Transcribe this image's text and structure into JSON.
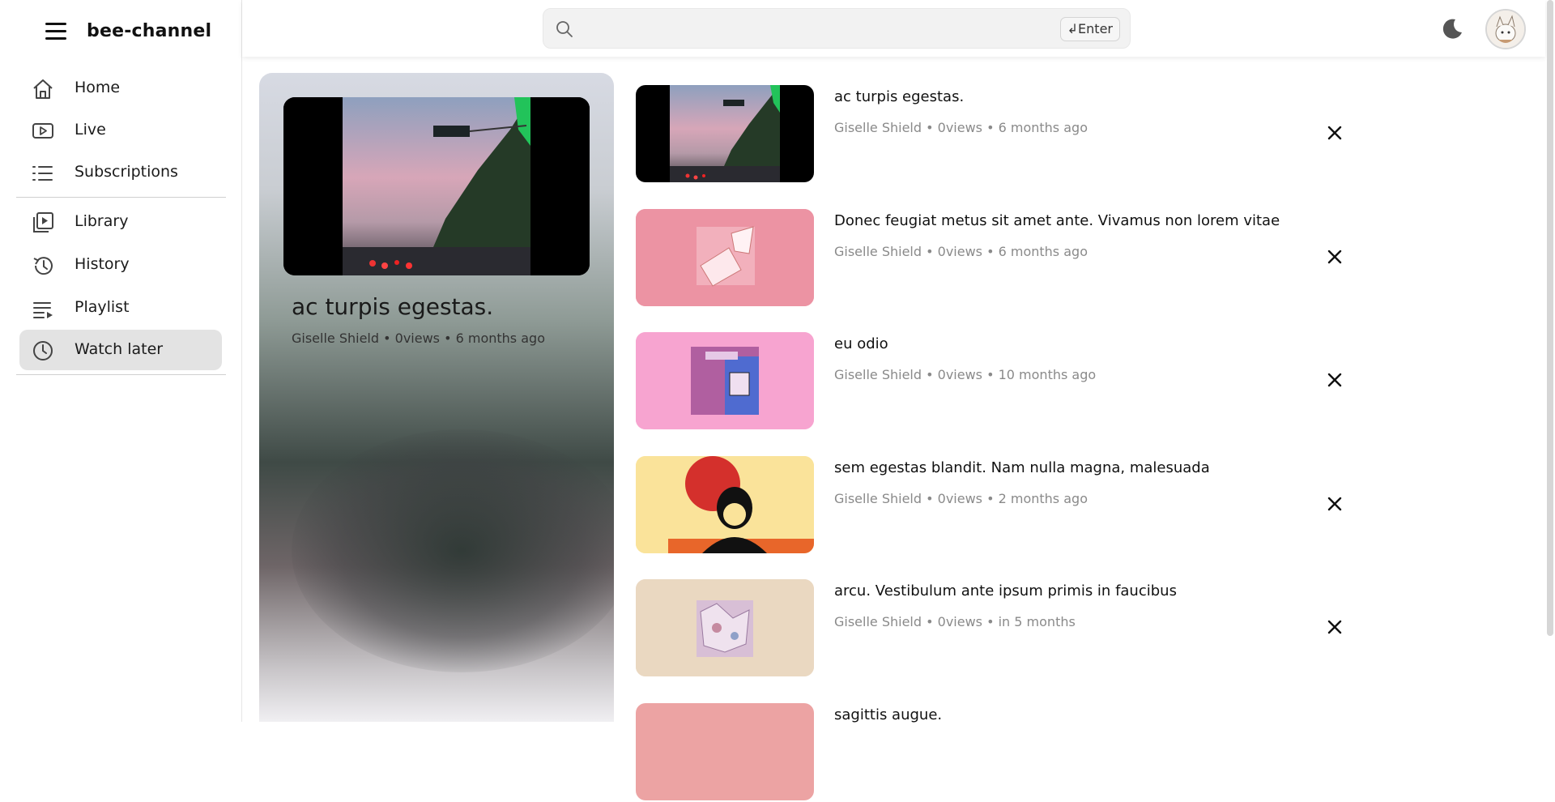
{
  "app": {
    "name": "bee-channel"
  },
  "sidebar": {
    "items": [
      {
        "label": "Home",
        "icon": "home-icon",
        "active": false
      },
      {
        "label": "Live",
        "icon": "live-icon",
        "active": false
      },
      {
        "label": "Subscriptions",
        "icon": "list-icon",
        "active": false
      },
      {
        "label": "Library",
        "icon": "library-icon",
        "active": false
      },
      {
        "label": "History",
        "icon": "history-icon",
        "active": false
      },
      {
        "label": "Playlist",
        "icon": "playlist-icon",
        "active": false
      },
      {
        "label": "Watch later",
        "icon": "clock-icon",
        "active": true
      }
    ]
  },
  "header": {
    "search_placeholder": "",
    "enter_key": "↲Enter",
    "theme_icon": "moon-icon",
    "avatar_icon": "avatar"
  },
  "hero": {
    "title": "ac turpis egestas.",
    "meta": "Giselle Shield • 0views • 6 months ago"
  },
  "videos": [
    {
      "title": "ac turpis egestas.",
      "meta": "Giselle Shield • 0views • 6 months ago",
      "thumb_bg": "#000000"
    },
    {
      "title": "Donec feugiat metus sit amet ante. Vivamus non lorem vitae",
      "meta": "Giselle Shield • 0views • 6 months ago",
      "thumb_bg": "#ec93a3"
    },
    {
      "title": "eu odio",
      "meta": "Giselle Shield • 0views • 10 months ago",
      "thumb_bg": "#f7a4d0"
    },
    {
      "title": "sem egestas blandit. Nam nulla magna, malesuada",
      "meta": "Giselle Shield • 0views • 2 months ago",
      "thumb_bg": "#fae39a"
    },
    {
      "title": "arcu. Vestibulum ante ipsum primis in faucibus",
      "meta": "Giselle Shield • 0views • in 5 months",
      "thumb_bg": "#ead8c1"
    },
    {
      "title": "sagittis augue.",
      "meta": "",
      "thumb_bg": "#eca3a3"
    }
  ]
}
